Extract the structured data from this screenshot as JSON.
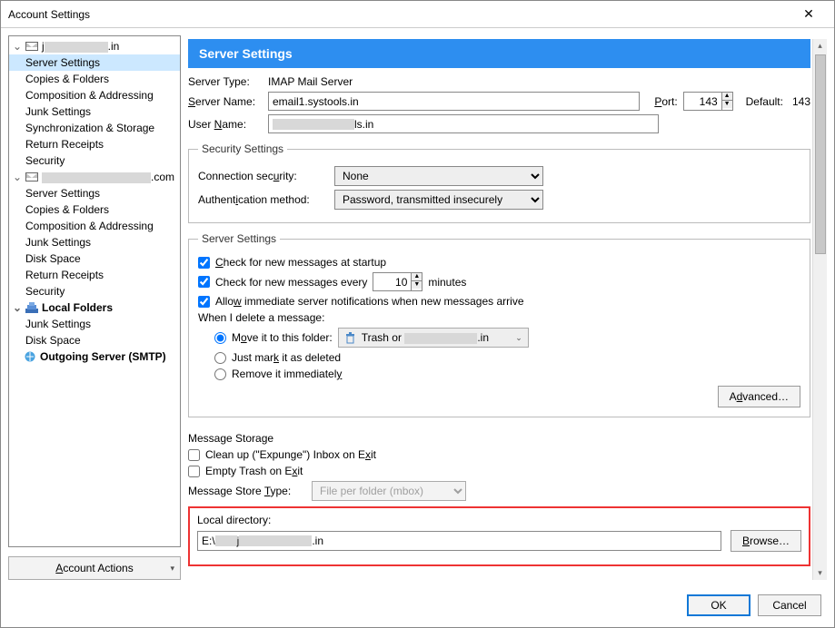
{
  "window": {
    "title": "Account Settings"
  },
  "sidebar": {
    "accounts": [
      {
        "label_prefix": "j",
        "label_suffix": ".in",
        "items": [
          "Server Settings",
          "Copies & Folders",
          "Composition & Addressing",
          "Junk Settings",
          "Synchronization & Storage",
          "Return Receipts",
          "Security"
        ]
      },
      {
        "label_suffix": ".com",
        "items": [
          "Server Settings",
          "Copies & Folders",
          "Composition & Addressing",
          "Junk Settings",
          "Disk Space",
          "Return Receipts",
          "Security"
        ]
      }
    ],
    "local": {
      "label": "Local Folders",
      "items": [
        "Junk Settings",
        "Disk Space"
      ]
    },
    "smtp": "Outgoing Server (SMTP)",
    "actions_label": "Account Actions"
  },
  "panel": {
    "heading": "Server Settings",
    "server_type_label": "Server Type:",
    "server_type_value": "IMAP Mail Server",
    "server_name_label": "Server Name:",
    "server_name_value": "email1.systools.in",
    "port_label": "Port:",
    "port_value": "143",
    "default_label": "Default:",
    "default_value": "143",
    "user_name_label": "User Name:",
    "user_name_suffix": "ls.in"
  },
  "security": {
    "legend": "Security Settings",
    "conn_label": "Connection security:",
    "conn_value": "None",
    "auth_label": "Authentication method:",
    "auth_value": "Password, transmitted insecurely"
  },
  "server": {
    "legend": "Server Settings",
    "chk_startup": "Check for new messages at startup",
    "chk_every_pre": "Check for new messages every",
    "chk_every_value": "10",
    "chk_every_unit": "minutes",
    "chk_allow": "Allow immediate server notifications when new messages arrive",
    "delete_label": "When I delete a message:",
    "opt_move": "Move it to this folder:",
    "move_folder_prefix": "Trash or",
    "move_folder_suffix": ".in",
    "opt_mark": "Just mark it as deleted",
    "opt_remove": "Remove it immediately",
    "advanced": "Advanced…"
  },
  "storage": {
    "legend": "Message Storage",
    "chk_expunge": "Clean up (\"Expunge\") Inbox on Exit",
    "chk_empty": "Empty Trash on Exit",
    "store_type_label": "Message Store Type:",
    "store_type_value": "File per folder (mbox)",
    "local_dir_label": "Local directory:",
    "local_dir_prefix": "E:\\",
    "local_dir_mid": "j",
    "local_dir_suffix": ".in",
    "browse": "Browse…"
  },
  "footer": {
    "ok": "OK",
    "cancel": "Cancel"
  }
}
